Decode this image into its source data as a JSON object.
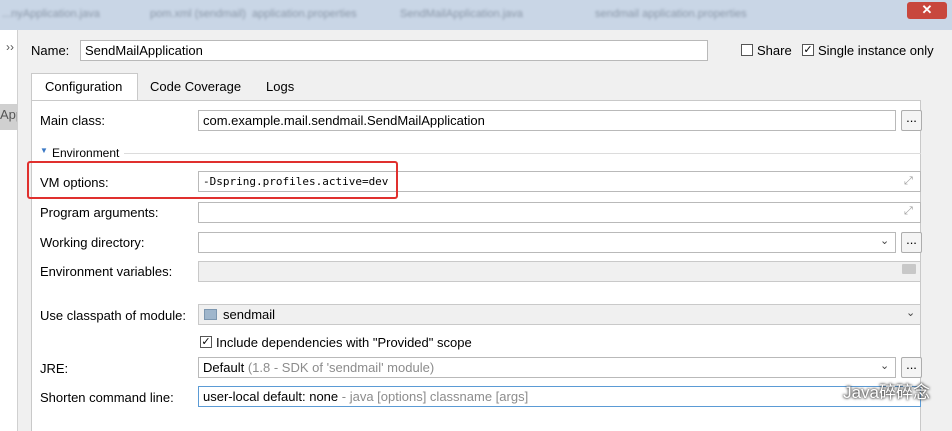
{
  "window": {
    "tabs": [
      "...nyApplication.java",
      "pom.xml (sendmail)",
      "application.properties",
      "SendMailApplication.java",
      "sendmail application.properties"
    ],
    "close_glyph": "✕"
  },
  "left_panel": {
    "clipped_text": "App"
  },
  "header": {
    "name_label": "Name:",
    "name_value": "SendMailApplication",
    "share_label": "Share",
    "share_checked": false,
    "single_instance_label": "Single instance only",
    "single_instance_checked": true
  },
  "tabs": [
    "Configuration",
    "Code Coverage",
    "Logs"
  ],
  "form": {
    "main_class_label": "Main class:",
    "main_class_value": "com.example.mail.sendmail.SendMailApplication",
    "environment_label": "Environment",
    "vm_options_label": "VM options:",
    "vm_options_value": "-Dspring.profiles.active=dev",
    "program_args_label": "Program arguments:",
    "program_args_value": "",
    "working_dir_label": "Working directory:",
    "working_dir_value": "",
    "env_vars_label": "Environment variables:",
    "env_vars_value": "",
    "classpath_label": "Use classpath of module:",
    "classpath_value": "sendmail",
    "include_deps_label": "Include dependencies with \"Provided\" scope",
    "include_deps_checked": true,
    "jre_label": "JRE:",
    "jre_value": "Default",
    "jre_hint": "(1.8 - SDK of 'sendmail' module)",
    "shorten_label": "Shorten command line:",
    "shorten_value": "user-local default: none",
    "shorten_hint": " - java [options] classname [args]",
    "browse_label": "..."
  },
  "watermark": "Java碎碎念",
  "colors": {
    "highlight_red": "#e0302e",
    "focus_blue": "#5b9bd5"
  }
}
